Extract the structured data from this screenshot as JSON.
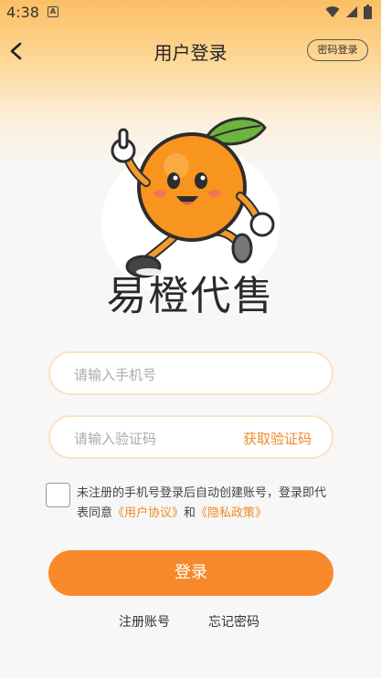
{
  "status_bar": {
    "time": "4:38",
    "notification_icon_letter": "A"
  },
  "header": {
    "title": "用户登录",
    "password_login_label": "密码登录"
  },
  "logo": {
    "brand_name": "易橙代售",
    "mascot": "orange-mascot-icon"
  },
  "form": {
    "phone_placeholder": "请输入手机号",
    "code_placeholder": "请输入验证码",
    "get_code_label": "获取验证码"
  },
  "agreement": {
    "text_prefix": "未注册的手机号登录后自动创建账号，登录即代表同意",
    "user_agreement": "《用户协议》",
    "and": "和",
    "privacy_policy": "《隐私政策》"
  },
  "actions": {
    "login_label": "登录",
    "register_label": "注册账号",
    "forgot_label": "忘记密码"
  },
  "colors": {
    "accent": "#f8892a",
    "link": "#f08a24",
    "header_gradient": "#fbbf63"
  }
}
